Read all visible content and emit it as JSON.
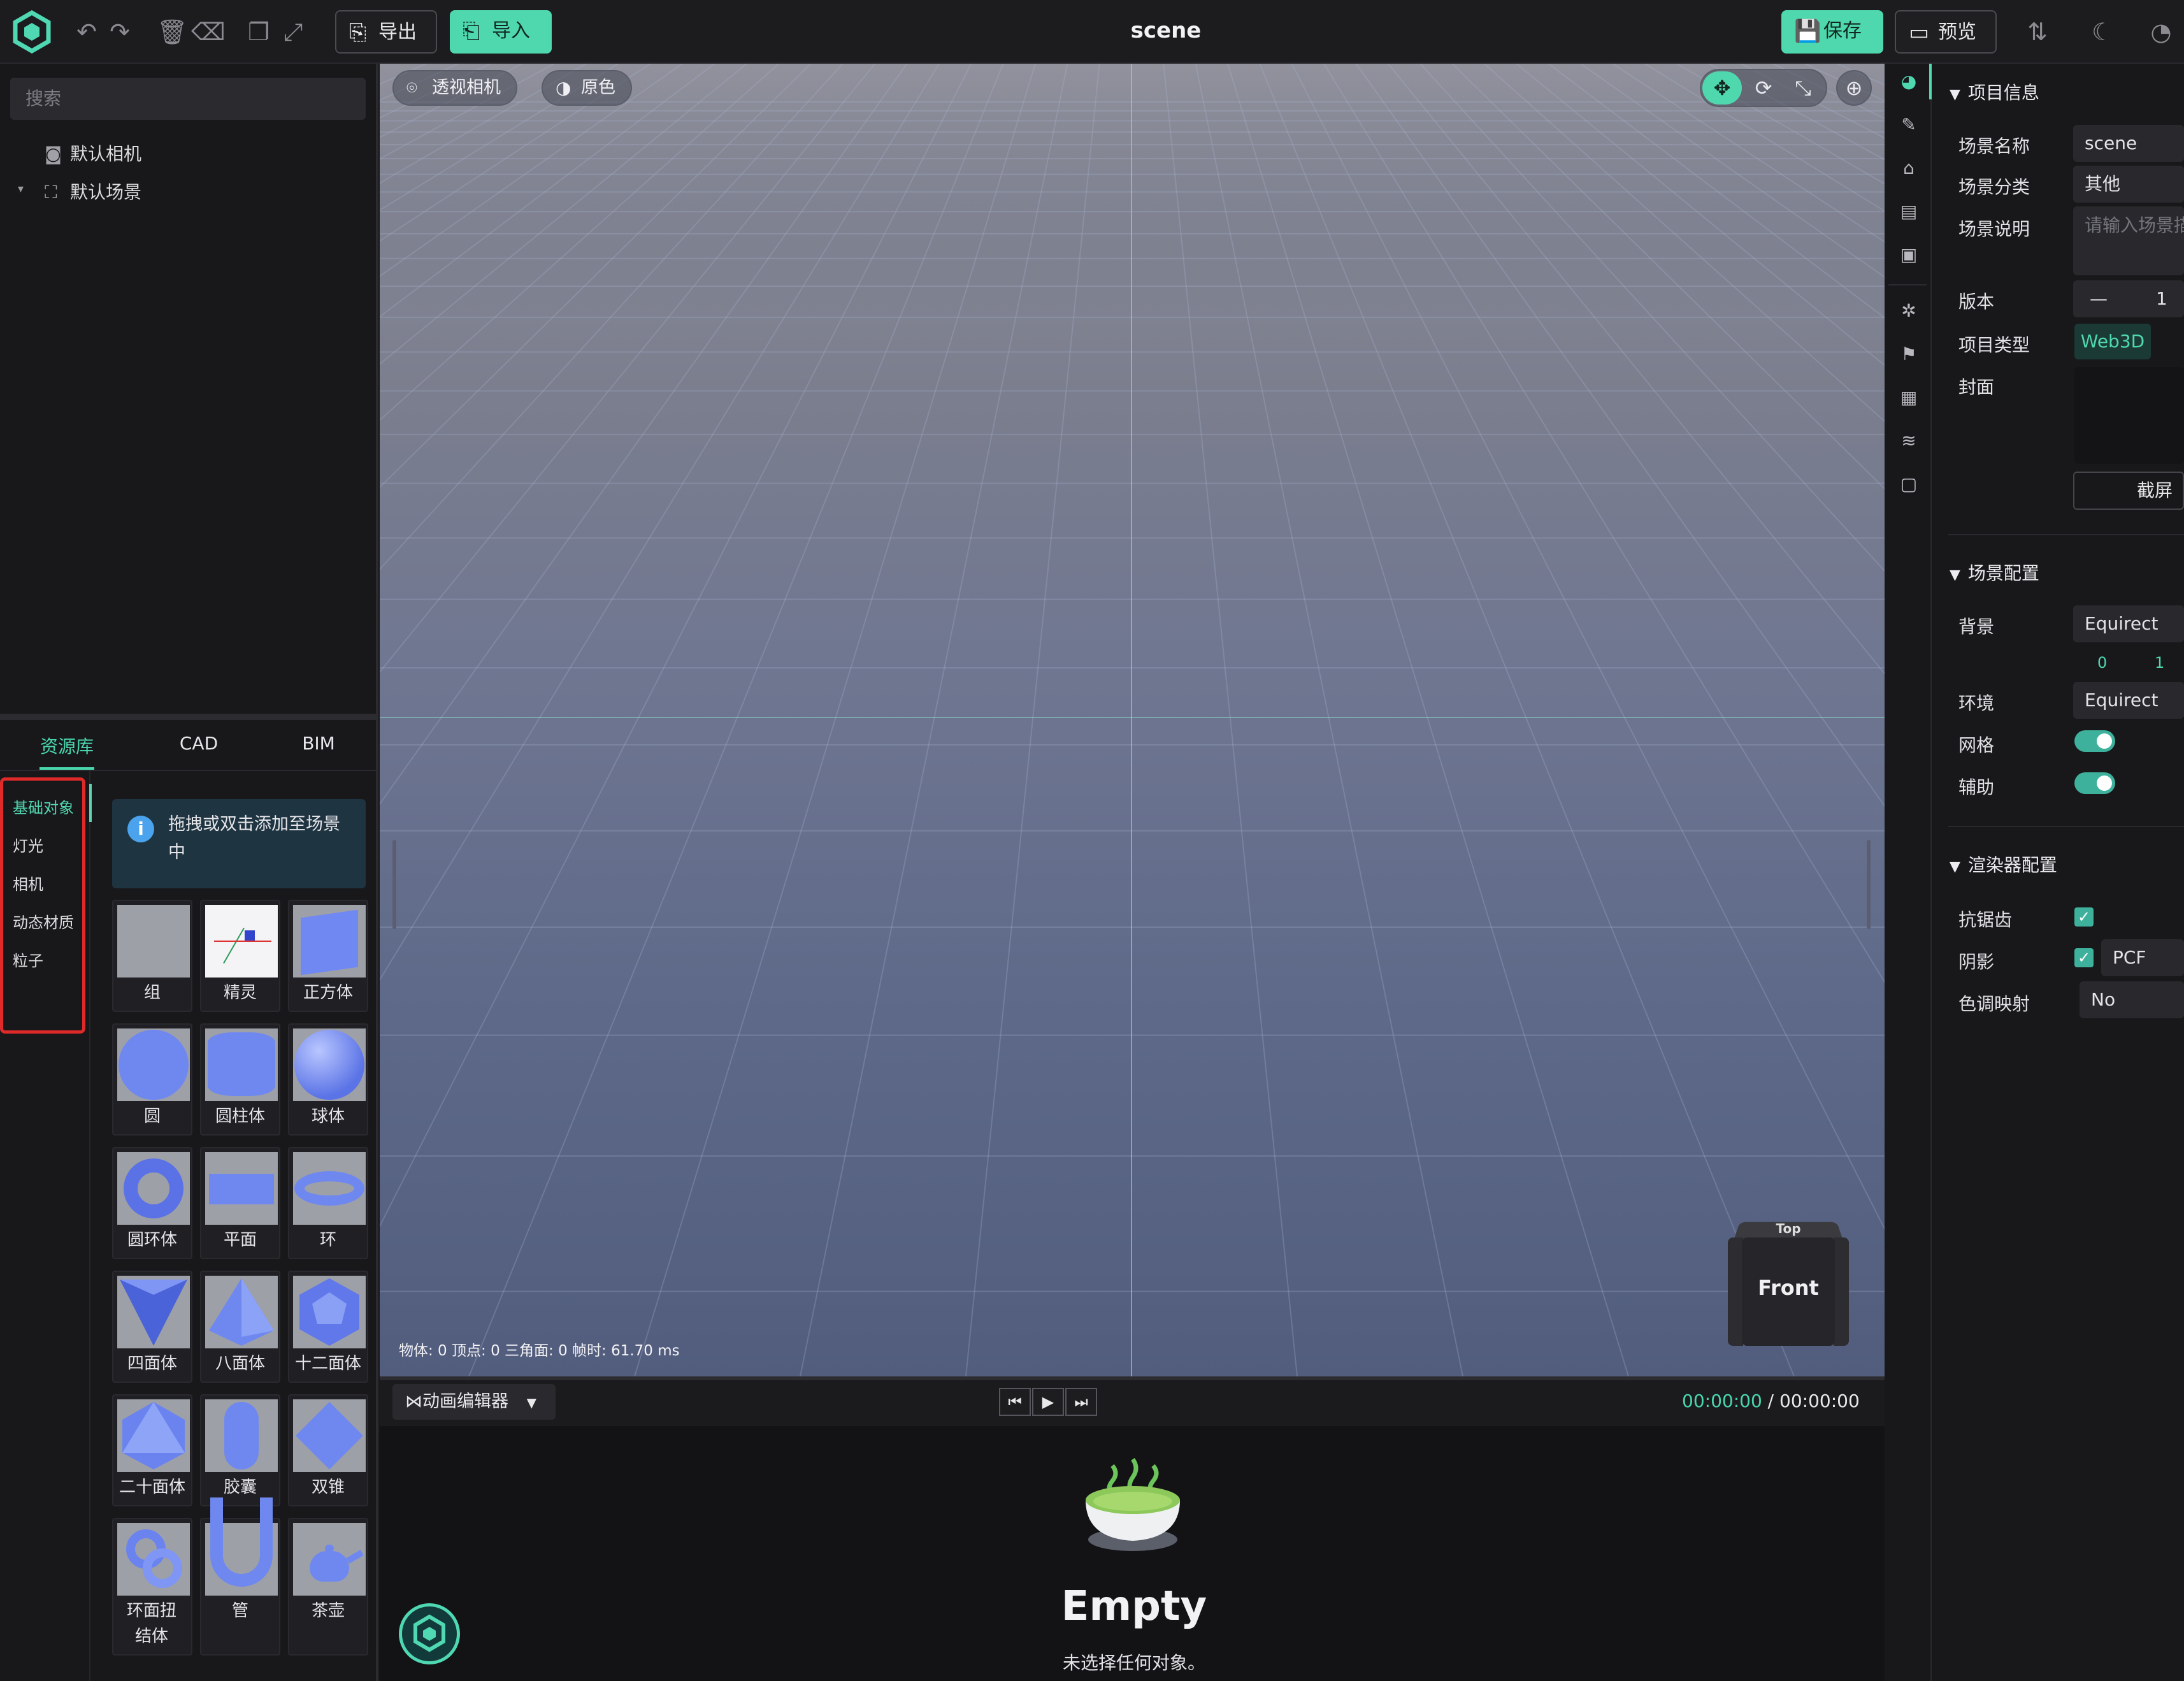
{
  "app": {
    "title": "scene"
  },
  "toolbar": {
    "export_label": "导出",
    "import_label": "导入",
    "save_label": "保存",
    "preview_label": "预览"
  },
  "outliner": {
    "search_placeholder": "搜索",
    "items": [
      {
        "label": "默认相机"
      },
      {
        "label": "默认场景"
      }
    ]
  },
  "library": {
    "tabs": [
      {
        "label": "资源库"
      },
      {
        "label": "CAD"
      },
      {
        "label": "BIM"
      }
    ],
    "categories": [
      {
        "label": "基础对象"
      },
      {
        "label": "灯光"
      },
      {
        "label": "相机"
      },
      {
        "label": "动态材质"
      },
      {
        "label": "粒子"
      }
    ],
    "hint": "拖拽或双击添加至场景中",
    "assets": [
      {
        "label": "组"
      },
      {
        "label": "精灵"
      },
      {
        "label": "正方体"
      },
      {
        "label": "圆"
      },
      {
        "label": "圆柱体"
      },
      {
        "label": "球体"
      },
      {
        "label": "圆环体"
      },
      {
        "label": "平面"
      },
      {
        "label": "环"
      },
      {
        "label": "四面体"
      },
      {
        "label": "八面体"
      },
      {
        "label": "十二面体"
      },
      {
        "label": "二十面体"
      },
      {
        "label": "胶囊"
      },
      {
        "label": "双锥"
      },
      {
        "label": "环面扭结体"
      },
      {
        "label": "管"
      },
      {
        "label": "茶壶"
      }
    ]
  },
  "viewport": {
    "camera_label": "透视相机",
    "shading_label": "原色",
    "stats": "物体: 0  顶点: 0  三角面: 0  帧时: 61.70 ms",
    "cube_front": "Front",
    "cube_top": "Top"
  },
  "animation": {
    "editor_label": "动画编辑器",
    "time_current": "00:00:00",
    "time_separator": " / ",
    "time_total": "00:00:00",
    "empty_title": "Empty",
    "empty_subtitle": "未选择任何对象。"
  },
  "properties": {
    "project": {
      "section": "项目信息",
      "scene_name_label": "场景名称",
      "scene_name_value": "scene",
      "category_label": "场景分类",
      "category_value": "其他",
      "desc_label": "场景说明",
      "desc_placeholder": "请输入场景描",
      "version_label": "版本",
      "version_minus": "—",
      "version_value": "1",
      "type_label": "项目类型",
      "type_value": "Web3D",
      "cover_label": "封面",
      "screenshot_label": "截屏"
    },
    "scene": {
      "section": "场景配置",
      "background_label": "背景",
      "background_value": "Equirect",
      "bg_num_a": "0",
      "bg_num_b": "1",
      "environment_label": "环境",
      "environment_value": "Equirect",
      "grid_label": "网格",
      "helper_label": "辅助"
    },
    "renderer": {
      "section": "渲染器配置",
      "antialias_label": "抗锯齿",
      "shadow_label": "阴影",
      "shadow_value": "PCF",
      "tonemap_label": "色调映射",
      "tonemap_value": "No"
    }
  },
  "colors": {
    "accent": "#3ed2a8",
    "danger_outline": "#e02a2a"
  }
}
